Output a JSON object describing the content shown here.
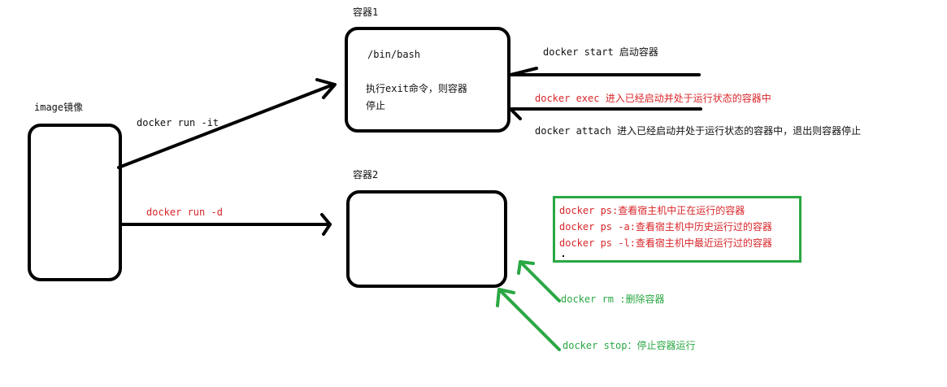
{
  "image_label": "image镜像",
  "container1": {
    "title": "容器1",
    "line1": "/bin/bash",
    "line2": "执行exit命令，则容器",
    "line3": "停止"
  },
  "container2": {
    "title": "容器2"
  },
  "arrows": {
    "run_it": "docker run -it",
    "run_d": "docker run  -d"
  },
  "right_notes": {
    "start": "docker start 启动容器",
    "exec": "docker exec 进入已经启动并处于运行状态的容器中",
    "attach": "docker attach  进入已经启动并处于运行状态的容器中，退出则容器停止"
  },
  "ps_box": {
    "items": [
      "docker ps:查看宿主机中正在运行的容器",
      "docker ps -a:查看宿主机中历史运行过的容器",
      "docker ps -l:查看宿主机中最近运行过的容器"
    ]
  },
  "bottom_notes": {
    "rm": "docker rm :删除容器",
    "stop": "docker stop：停止容器运行"
  },
  "colors": {
    "black": "#000000",
    "red": "#d9262a",
    "green": "#2aa843"
  }
}
